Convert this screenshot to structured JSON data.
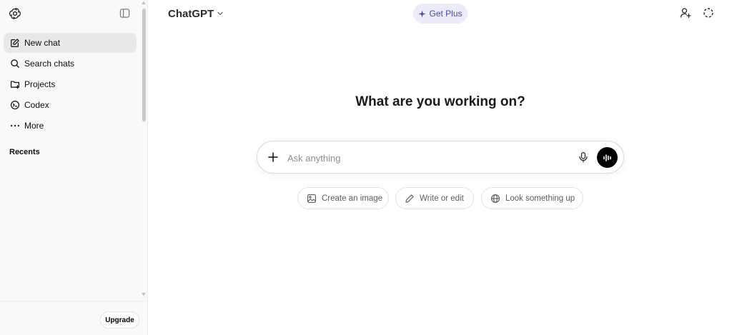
{
  "sidebar": {
    "items": [
      {
        "label": "New chat",
        "icon": "edit-icon"
      },
      {
        "label": "Search chats",
        "icon": "search-icon"
      },
      {
        "label": "Projects",
        "icon": "folder-plus-icon"
      },
      {
        "label": "Codex",
        "icon": "codex-icon"
      },
      {
        "label": "More",
        "icon": "more-dots-icon"
      }
    ],
    "recents_label": "Recents",
    "upgrade_label": "Upgrade"
  },
  "header": {
    "model_name": "ChatGPT",
    "get_plus_label": "Get Plus"
  },
  "main": {
    "headline": "What are you working on?",
    "composer_placeholder": "Ask anything",
    "chips": [
      {
        "label": "Create an image",
        "icon": "image-icon"
      },
      {
        "label": "Write or edit",
        "icon": "pencil-icon"
      },
      {
        "label": "Look something up",
        "icon": "globe-icon"
      }
    ]
  },
  "colors": {
    "sidebar_bg": "#f9f9f9",
    "active_item_bg": "#e8e8e8",
    "plus_badge_bg": "#ececf9",
    "plus_badge_text": "#4b4ba0",
    "voice_button_bg": "#000000"
  }
}
